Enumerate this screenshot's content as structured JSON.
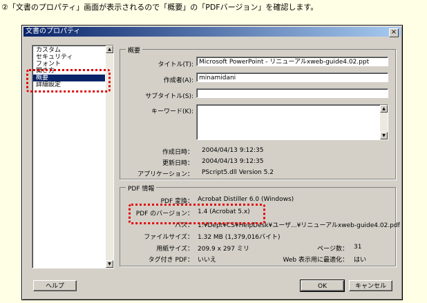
{
  "instruction": "②「文書のプロパティ」画面が表示されるので「概要」の「PDFバージョン」を確認します。",
  "window": {
    "title": "文書のプロパティ",
    "close_glyph": "×"
  },
  "sidebar": {
    "items": [
      {
        "label": "カスタム",
        "selected": false
      },
      {
        "label": "セキュリティ",
        "selected": false
      },
      {
        "label": "フォント",
        "selected": false
      },
      {
        "label": "開き方",
        "selected": false
      },
      {
        "label": "概要",
        "selected": true
      },
      {
        "label": "詳細設定",
        "selected": false
      }
    ]
  },
  "summary": {
    "group_title": "概要",
    "title_label": "タイトル(T):",
    "title_value": "Microsoft PowerPoint - リニューアルxweb-guide4.02.ppt",
    "author_label": "作成者(A):",
    "author_value": "minamidani",
    "subject_label": "サブタイトル(S):",
    "subject_value": "",
    "keywords_label": "キーワード(K):",
    "keywords_value": "",
    "created_label": "作成日時：",
    "created_value": "2004/04/13 9:12:35",
    "modified_label": "更新日時：",
    "modified_value": "2004/04/13 9:12:35",
    "application_label": "アプリケーション：",
    "application_value": "PScript5.dll Version 5.2"
  },
  "pdf_info": {
    "group_title": "PDF 情報",
    "producer_label": "PDF 変換：",
    "producer_value": "Acrobat Distiller 6.0 (Windows)",
    "version_label": "PDF のバージョン：",
    "version_value": "1.4 (Acrobat 5.x)",
    "path_label": "パス：",
    "path_value": "1:¥Dept¥CS¥HelpDesk¥ユーザ...¥リニューアルxweb-guide4.02.pdf",
    "filesize_label": "ファイルサイズ：",
    "filesize_value": "1.32 MB (1,379,016バイト)",
    "papersize_label": "用紙サイズ：",
    "papersize_value": "209.9 x 297 ミリ",
    "pages_label": "ページ数：",
    "pages_value": "31",
    "tagged_label": "タグ付き PDF：",
    "tagged_value": "いいえ",
    "fastweb_label": "Web 表示用に最適化：",
    "fastweb_value": "はい"
  },
  "buttons": {
    "help": "ヘルプ",
    "ok": "OK",
    "cancel": "キャンセル"
  },
  "colors": {
    "highlight": "#e00000",
    "selection": "#0a246a",
    "background": "#ffffe6"
  }
}
